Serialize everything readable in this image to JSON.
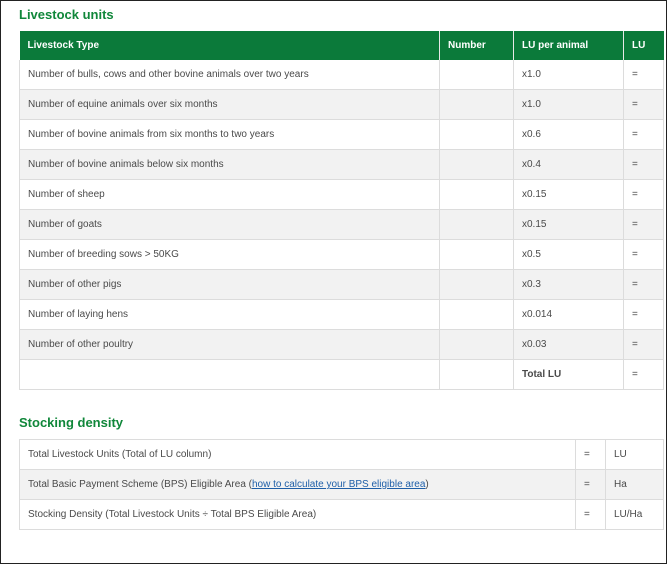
{
  "livestock_units": {
    "title": "Livestock units",
    "headers": [
      "Livestock Type",
      "Number",
      "LU per animal",
      "LU"
    ],
    "rows": [
      {
        "type": "Number of bulls, cows and other bovine animals over two years",
        "number": "",
        "lu_per_animal": "x1.0",
        "lu": "="
      },
      {
        "type": "Number of equine animals over six months",
        "number": "",
        "lu_per_animal": "x1.0",
        "lu": "="
      },
      {
        "type": "Number of bovine animals from six months to two years",
        "number": "",
        "lu_per_animal": "x0.6",
        "lu": "="
      },
      {
        "type": "Number of bovine animals below six months",
        "number": "",
        "lu_per_animal": "x0.4",
        "lu": "="
      },
      {
        "type": "Number of sheep",
        "number": "",
        "lu_per_animal": "x0.15",
        "lu": "="
      },
      {
        "type": "Number of goats",
        "number": "",
        "lu_per_animal": "x0.15",
        "lu": "="
      },
      {
        "type": "Number of breeding sows > 50KG",
        "number": "",
        "lu_per_animal": "x0.5",
        "lu": "="
      },
      {
        "type": "Number of other pigs",
        "number": "",
        "lu_per_animal": "x0.3",
        "lu": "="
      },
      {
        "type": "Number of laying hens",
        "number": "",
        "lu_per_animal": "x0.014",
        "lu": "="
      },
      {
        "type": "Number of other poultry",
        "number": "",
        "lu_per_animal": "x0.03",
        "lu": "="
      }
    ],
    "total": {
      "label": "Total LU",
      "lu": "="
    }
  },
  "stocking_density": {
    "title": "Stocking density",
    "rows": [
      {
        "label": "Total Livestock Units (Total of LU column)",
        "eq": "=",
        "unit": "LU"
      },
      {
        "label_before": "Total Basic Payment Scheme (BPS) Eligible Area (",
        "link": "how to calculate your BPS eligible area",
        "label_after": ")",
        "eq": "=",
        "unit": "Ha"
      },
      {
        "label": "Stocking Density (Total Livestock Units ÷ Total BPS Eligible Area)",
        "eq": "=",
        "unit": "LU/Ha"
      }
    ]
  },
  "colors": {
    "header_green": "#0b7a3a",
    "title_green": "#10873a",
    "link_blue": "#1f5fa8"
  }
}
